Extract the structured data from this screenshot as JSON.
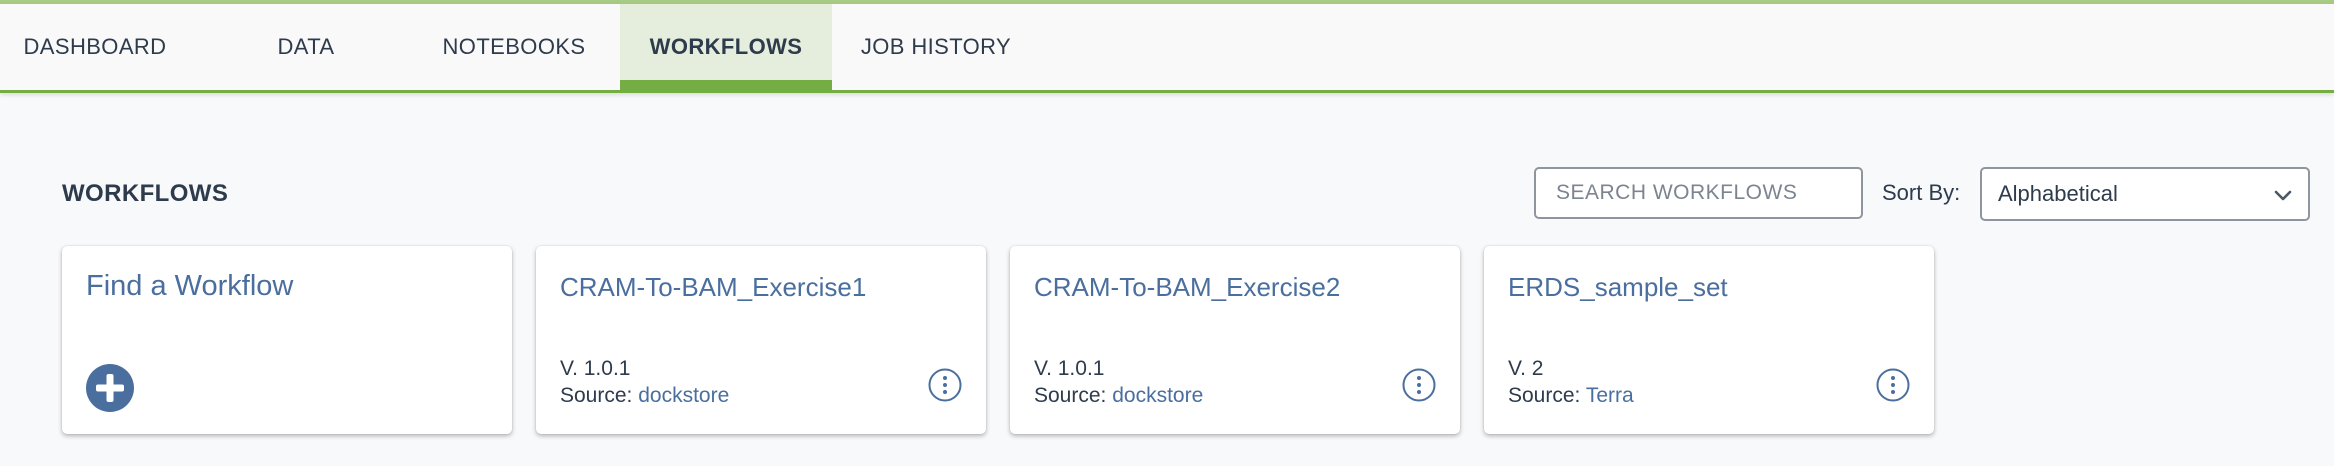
{
  "nav": {
    "tabs": [
      {
        "label": "DASHBOARD",
        "active": false
      },
      {
        "label": "DATA",
        "active": false
      },
      {
        "label": "NOTEBOOKS",
        "active": false
      },
      {
        "label": "WORKFLOWS",
        "active": true
      },
      {
        "label": "JOB HISTORY",
        "active": false
      }
    ]
  },
  "section": {
    "title": "WORKFLOWS"
  },
  "search": {
    "placeholder": "SEARCH WORKFLOWS",
    "value": ""
  },
  "sort": {
    "label": "Sort By:",
    "selected": "Alphabetical"
  },
  "find_card": {
    "title": "Find a Workflow",
    "icon": "plus-circle-icon"
  },
  "workflows": [
    {
      "name": "CRAM-To-BAM_Exercise1",
      "version": "V. 1.0.1",
      "source_label": "Source: ",
      "source": "dockstore"
    },
    {
      "name": "CRAM-To-BAM_Exercise2",
      "version": "V. 1.0.1",
      "source_label": "Source: ",
      "source": "dockstore"
    },
    {
      "name": "ERDS_sample_set",
      "version": "V. 2",
      "source_label": "Source: ",
      "source": "Terra"
    }
  ],
  "colors": {
    "accent_green": "#74ae43",
    "active_tab_bg": "#e5eedc",
    "link_blue": "#4a6f9e",
    "text_dark": "#2d3b4c"
  }
}
